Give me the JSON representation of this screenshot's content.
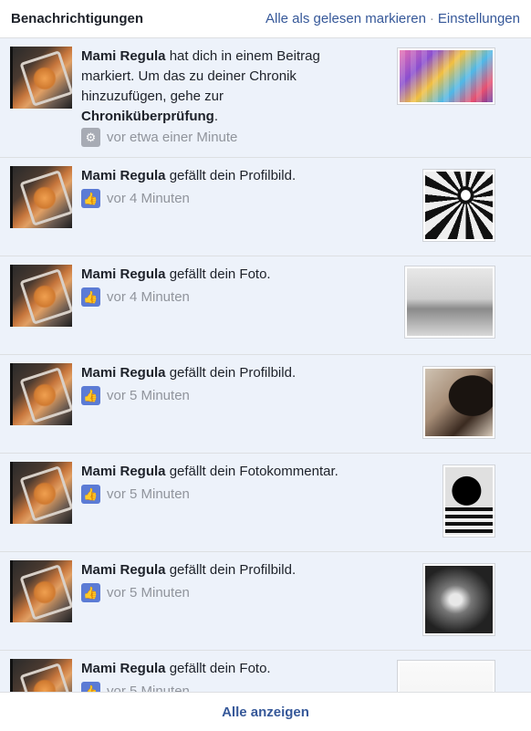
{
  "header": {
    "title": "Benachrichtigungen",
    "mark_all_read": "Alle als gelesen markieren",
    "separator": "·",
    "settings": "Einstellungen"
  },
  "notifications": [
    {
      "name": "Mami Regula",
      "text_a": " hat dich in einem Beitrag markiert. Um das zu deiner Chronik hinzuzufügen, gehe zur ",
      "bold_b": "Chroniküberprüfung",
      "text_c": ".",
      "time": "vor etwa einer Minute",
      "icon": "gear-icon"
    },
    {
      "name": "Mami Regula",
      "text": " gefällt dein Profilbild.",
      "time": "vor 4 Minuten",
      "icon": "like-icon"
    },
    {
      "name": "Mami Regula",
      "text": " gefällt dein Foto.",
      "time": "vor 4 Minuten",
      "icon": "like-icon"
    },
    {
      "name": "Mami Regula",
      "text": " gefällt dein Profilbild.",
      "time": "vor 5 Minuten",
      "icon": "like-icon"
    },
    {
      "name": "Mami Regula",
      "text": " gefällt dein Fotokommentar.",
      "time": "vor 5 Minuten",
      "icon": "like-icon"
    },
    {
      "name": "Mami Regula",
      "text": " gefällt dein Profilbild.",
      "time": "vor 5 Minuten",
      "icon": "like-icon"
    },
    {
      "name": "Mami Regula",
      "text": " gefällt dein Foto.",
      "time": "vor 5 Minuten",
      "icon": "like-icon"
    }
  ],
  "footer": {
    "see_all": "Alle anzeigen"
  },
  "colors": {
    "link": "#365899",
    "unread_bg": "#edf2fa",
    "like": "#5b7bd5",
    "meta": "#90949c"
  }
}
